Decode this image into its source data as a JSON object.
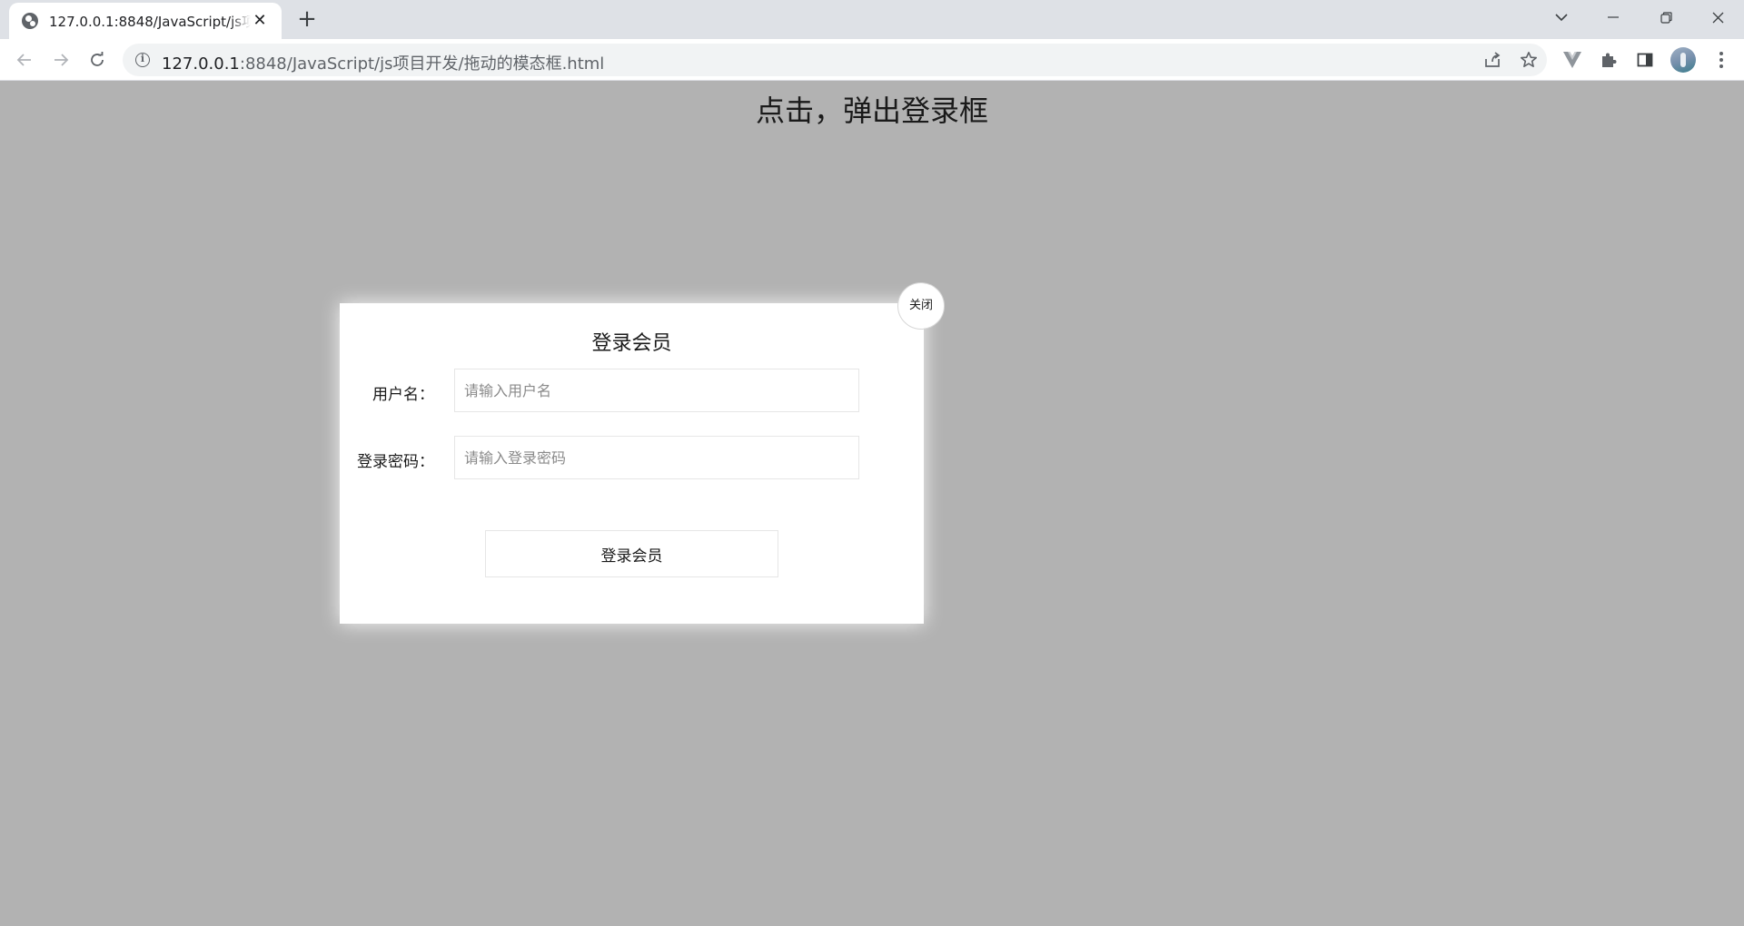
{
  "browser": {
    "tab_title": "127.0.0.1:8848/JavaScript/js项目开发/拖动的模态框.html",
    "new_tab_label": "+",
    "tab_close_label": "✕",
    "address_host": "127.0.0.1",
    "address_path": ":8848/JavaScript/js项目开发/拖动的模态框.html"
  },
  "page": {
    "title": "点击，弹出登录框"
  },
  "modal": {
    "title": "登录会员",
    "close_label": "关闭",
    "fields": [
      {
        "label": "用户名：",
        "placeholder": "请输入用户名"
      },
      {
        "label": "登录密码：",
        "placeholder": "请输入登录密码"
      }
    ],
    "submit_label": "登录会员"
  }
}
